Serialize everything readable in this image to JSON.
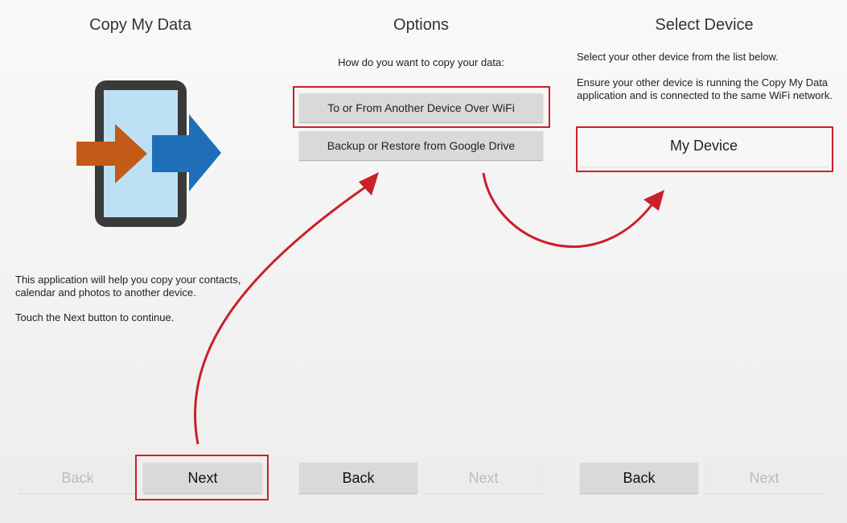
{
  "panel1": {
    "title": "Copy My Data",
    "icon": "phone-transfer-icon",
    "description": "This application will help you copy your contacts, calendar and photos to another device.",
    "hint": "Touch the Next button to continue.",
    "back_label": "Back",
    "next_label": "Next"
  },
  "panel2": {
    "title": "Options",
    "prompt": "How do you want to copy your data:",
    "option_wifi": "To or From Another Device Over WiFi",
    "option_drive": "Backup or Restore from Google Drive",
    "back_label": "Back",
    "next_label": "Next"
  },
  "panel3": {
    "title": "Select Device",
    "instruction": "Select your other device from the list below.",
    "note": "Ensure your other device is running the Copy My Data application and is connected to the same WiFi network.",
    "device_name": "My Device",
    "back_label": "Back",
    "next_label": "Next"
  },
  "colors": {
    "highlight": "#cc1f2a",
    "arrow_orange": "#c25a18",
    "arrow_blue": "#1f6fb8"
  }
}
